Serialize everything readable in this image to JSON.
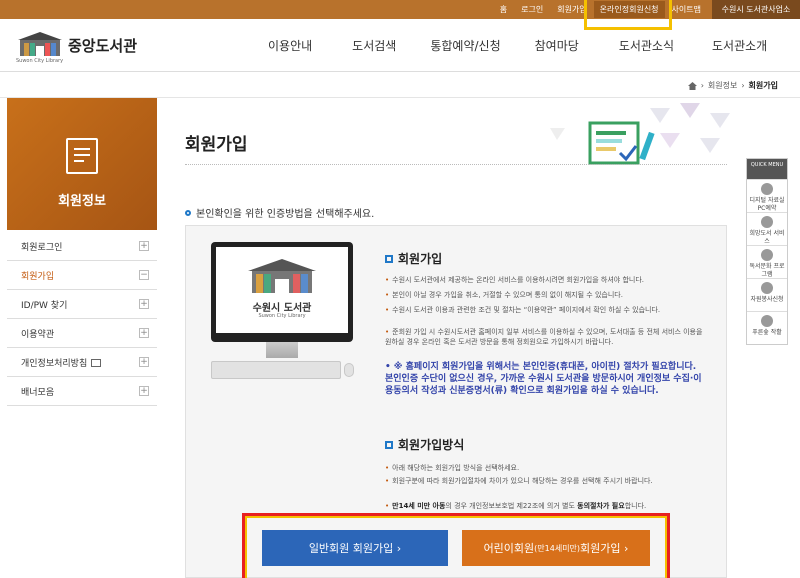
{
  "topbar": {
    "links": [
      "홈",
      "로그인",
      "회원가입",
      "온라인정회원신청",
      "사이트맵"
    ],
    "highlighted_index": 3,
    "branch_label": "수원시 도서관사업소"
  },
  "header": {
    "logo_name": "중앙도서관",
    "logo_sub": "Suwon City Library",
    "nav": [
      "이용안내",
      "도서검색",
      "통합예약/신청",
      "참여마당",
      "도서관소식",
      "도서관소개"
    ]
  },
  "breadcrumb": {
    "items": [
      "회원정보",
      "회원가입"
    ]
  },
  "sidebar": {
    "title": "회원정보",
    "items": [
      {
        "label": "회원로그인",
        "sign": "+"
      },
      {
        "label": "회원가입",
        "sign": "−"
      },
      {
        "label": "ID/PW 찾기",
        "sign": "+"
      },
      {
        "label": "이용약관",
        "sign": "+"
      },
      {
        "label": "개인정보처리방침",
        "sign": "+"
      },
      {
        "label": "배너모음",
        "sign": "+"
      }
    ]
  },
  "main": {
    "title": "회원가입",
    "guide": "본인확인을 위한 인증방법을 선택해주세요.",
    "monitor_title": "수원시 도서관",
    "monitor_sub": "Suwon City Library",
    "section1": {
      "title": "회원가입",
      "bullets": [
        "수원시 도서관에서 제공하는 온라인 서비스를 이용하시려면 회원가입을 하셔야 합니다.",
        "본인이 아닐 경우 가입을 취소, 거절할 수 있으며 통의 없이 해지될 수 있습니다.",
        "수원시 도서관 이용과 관련한 조건 및 절차는 “이용약관” 페이지에서 확인 하실 수 있습니다.",
        "준회원 가입 시 수원시도서관 홈페이지 일부 서비스를 이용하실 수 있으며, 도서대출 등 전체 서비스 이용을 원하실 경우 온라인 혹은 도서관 방문을 통해 정회원으로 가입하시기 바랍니다."
      ],
      "notice": "※ 홈페이지 회원가입을 위해서는 본인인증(휴대폰, 아이핀) 절차가 필요합니다. 본인인증 수단이 없으신 경우, 가까운 수원시 도서관을 방문하시어 개인정보 수집·이용동의서 작성과 신분증명서(류) 확인으로 회원가입을 하실 수 있습니다."
    },
    "section2": {
      "title": "회원가입방식",
      "bullets": [
        "아래 해당하는 회원가입 방식을 선택하세요.",
        "회원구분에 따라 회원가입절차에 차이가 있으니 해당하는 경우를 선택해 주시기 바랍니다."
      ],
      "notice_prefix": "만14세 미만 아동",
      "notice_mid": "의 경우 개인정보보호법 제22조에 의거 별도",
      "notice_strong": "동의절차가 필요",
      "notice_suffix": "합니다."
    },
    "buttons": {
      "general": "일반회원 회원가입 ›",
      "child_main": "어린이회원",
      "child_small": "(만14세미만)",
      "child_tail": " 회원가입 ›"
    }
  },
  "quick_menu": {
    "title": "QUICK MENU",
    "items": [
      "디지털 자료실PC예약",
      "희망도서 서비스",
      "독서문화 프로그램",
      "자원봉사신청",
      "푸른숲 작활"
    ]
  },
  "colors": {
    "brand": "#b8722c",
    "accent_blue": "#2c66b8",
    "accent_orange": "#d8701a"
  }
}
